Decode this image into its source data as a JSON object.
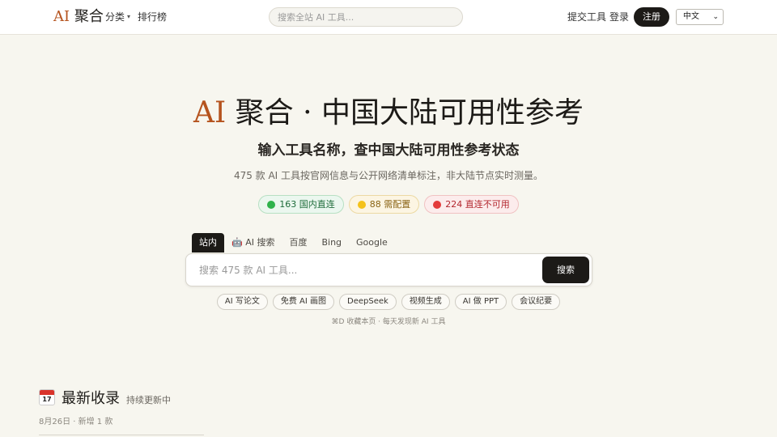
{
  "header": {
    "logo_ai": "AI",
    "logo_rest": "聚合",
    "nav_category": "分类",
    "nav_rank": "排行榜",
    "search_placeholder": "搜索全站 AI 工具...",
    "submit_tool": "提交工具",
    "login": "登录",
    "register": "注册",
    "language": "中文"
  },
  "hero": {
    "title_ai": "AI",
    "title_rest": " 聚合 · 中国大陆可用性参考",
    "subtitle": "输入工具名称，查中国大陆可用性参考状态",
    "description": "475 款 AI 工具按官网信息与公开网络清单标注，非大陆节点实时测量。",
    "badges": [
      {
        "label": "163 国内直连",
        "status": "green"
      },
      {
        "label": "88 需配置",
        "status": "yellow"
      },
      {
        "label": "224 直连不可用",
        "status": "red"
      }
    ]
  },
  "search": {
    "tabs": [
      "站内",
      "🤖 AI 搜索",
      "百度",
      "Bing",
      "Google"
    ],
    "active_tab": "站内",
    "placeholder": "搜索 475 款 AI 工具...",
    "button": "搜索",
    "chips": [
      "AI 写论文",
      "免费 AI 画图",
      "DeepSeek",
      "视频生成",
      "AI 做 PPT",
      "会议纪要"
    ],
    "hint": "⌘D 收藏本页 · 每天发现新 AI 工具"
  },
  "latest": {
    "icon": "calendar-icon",
    "icon_date": "17",
    "title": "最新收录",
    "subtitle": "持续更新中",
    "date_line": "8月26日 · 新增 1 款"
  },
  "colors": {
    "accent": "#b5531e",
    "dark": "#1c1a17",
    "background": "#f7f6ef"
  }
}
